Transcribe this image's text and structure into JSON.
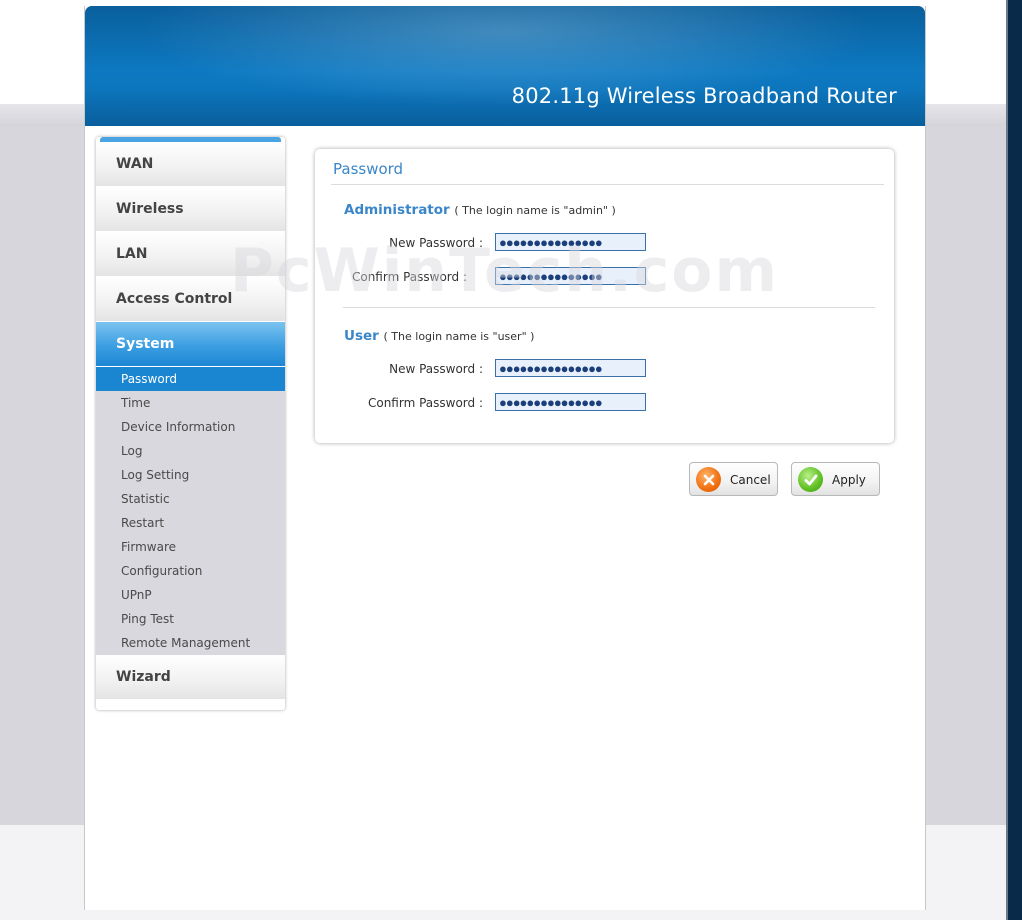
{
  "header": {
    "title": "802.11g Wireless Broadband Router"
  },
  "sidebar": {
    "menu_top": [
      {
        "label": "WAN"
      },
      {
        "label": "Wireless"
      },
      {
        "label": "LAN"
      },
      {
        "label": "Access Control"
      },
      {
        "label": "System"
      }
    ],
    "submenu": [
      {
        "label": "Password"
      },
      {
        "label": "Time"
      },
      {
        "label": "Device Information"
      },
      {
        "label": "Log"
      },
      {
        "label": "Log Setting"
      },
      {
        "label": "Statistic"
      },
      {
        "label": "Restart"
      },
      {
        "label": "Firmware"
      },
      {
        "label": "Configuration"
      },
      {
        "label": "UPnP"
      },
      {
        "label": "Ping Test"
      },
      {
        "label": "Remote Management"
      }
    ],
    "menu_bottom": {
      "label": "Wizard"
    }
  },
  "panel": {
    "title": "Password",
    "admin": {
      "title": "Administrator",
      "note": "( The login name is \"admin\" )",
      "new_label": "New Password :",
      "confirm_label": "Confirm Password :",
      "new_value": "●●●●●●●●●●●●●●●",
      "confirm_value": "●●●●●●●●●●●●●●●"
    },
    "user": {
      "title": "User",
      "note": "( The login name is \"user\" )",
      "new_label": "New Password :",
      "confirm_label": "Confirm Password :",
      "new_value": "●●●●●●●●●●●●●●●",
      "confirm_value": "●●●●●●●●●●●●●●●"
    }
  },
  "buttons": {
    "cancel": "Cancel",
    "apply": "Apply"
  },
  "watermark": "PcWinTech.com"
}
